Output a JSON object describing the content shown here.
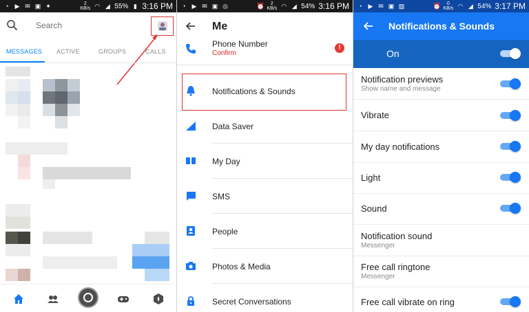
{
  "colors": {
    "accent": "#1877f2",
    "accent_dark": "#1565c0",
    "alert": "#e53935",
    "highlight_box": "#dd3333"
  },
  "panel1": {
    "status": {
      "battery": "55%",
      "time": "3:16 PM",
      "data_rate_top": "2",
      "data_rate_unit": "KB/s"
    },
    "search_placeholder": "Search",
    "tabs": [
      "MESSAGES",
      "ACTIVE",
      "GROUPS",
      "CALLS"
    ],
    "active_tab": "MESSAGES",
    "bottom_icons": [
      "home-icon",
      "people-icon",
      "camera-icon",
      "games-icon",
      "discover-icon"
    ]
  },
  "panel2": {
    "status": {
      "battery": "54%",
      "time": "3:16 PM",
      "data_rate_top": "2",
      "data_rate_unit": "KB/s"
    },
    "title": "Me",
    "phone": {
      "label": "Phone Number",
      "sub": "Confirm",
      "badge": "!"
    },
    "items": [
      {
        "label": "Notifications & Sounds",
        "icon": "bell-icon"
      },
      {
        "label": "Data Saver",
        "icon": "data-saver-icon"
      },
      {
        "label": "My Day",
        "icon": "my-day-icon"
      },
      {
        "label": "SMS",
        "icon": "sms-icon"
      },
      {
        "label": "People",
        "icon": "contacts-icon"
      },
      {
        "label": "Photos & Media",
        "icon": "camera-icon"
      },
      {
        "label": "Secret Conversations",
        "icon": "lock-icon"
      }
    ]
  },
  "panel3": {
    "status": {
      "battery": "54%",
      "time": "3:17 PM",
      "data_rate_top": "0",
      "data_rate_unit": "KB/s"
    },
    "title": "Notifications & Sounds",
    "master": {
      "label": "On",
      "enabled": true
    },
    "rows": [
      {
        "label": "Notification previews",
        "sub": "Show name and message",
        "toggle": true
      },
      {
        "label": "Vibrate",
        "sub": "",
        "toggle": true
      },
      {
        "label": "My day notifications",
        "sub": "",
        "toggle": true
      },
      {
        "label": "Light",
        "sub": "",
        "toggle": true
      },
      {
        "label": "Sound",
        "sub": "",
        "toggle": true
      },
      {
        "label": "Notification sound",
        "sub": "Messenger",
        "toggle": null
      },
      {
        "label": "Free call ringtone",
        "sub": "Messenger",
        "toggle": null
      },
      {
        "label": "Free call vibrate on ring",
        "sub": "",
        "toggle": true
      }
    ]
  }
}
